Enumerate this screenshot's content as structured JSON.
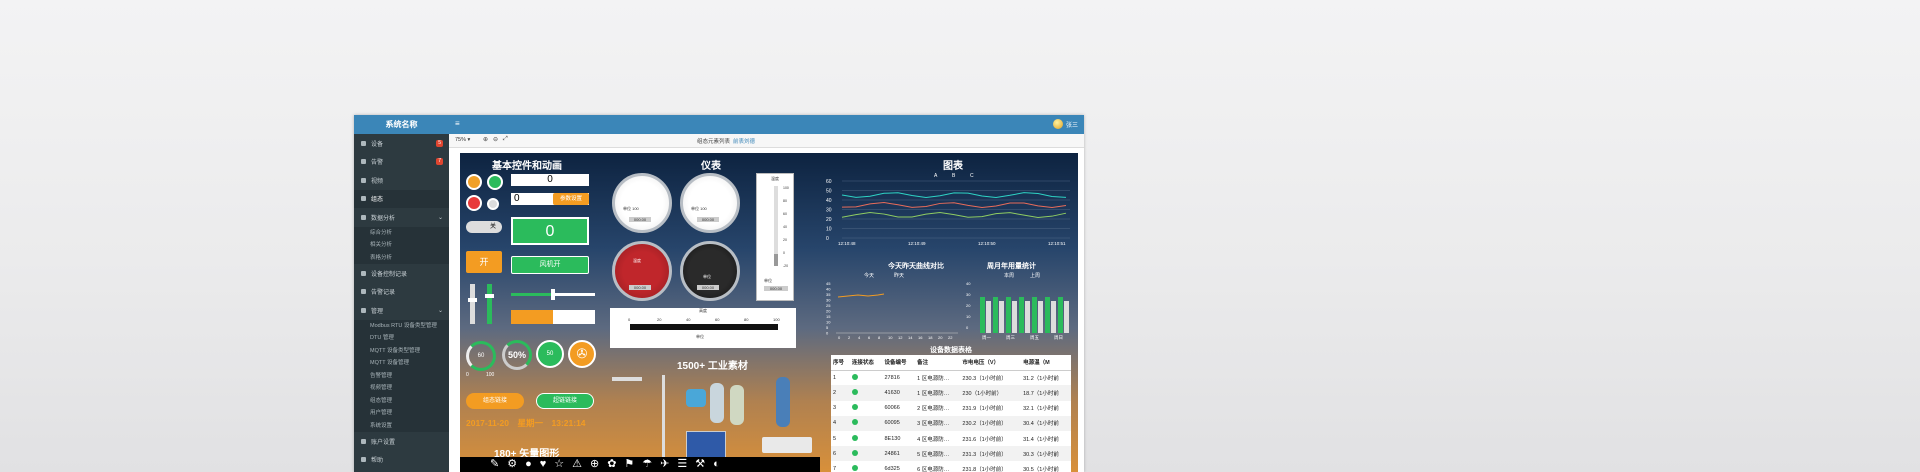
{
  "brand": "系统名称",
  "user": {
    "name": "张三"
  },
  "sidebar": {
    "items": [
      {
        "label": "设备",
        "badge": "5"
      },
      {
        "label": "告警",
        "badge": "7"
      },
      {
        "label": "视频"
      },
      {
        "label": "组态"
      },
      {
        "label": "数据分析",
        "subs": [
          "综合分析",
          "相关分析",
          "表格分析"
        ]
      },
      {
        "label": "设备控制记录"
      },
      {
        "label": "告警记录"
      },
      {
        "label": "管理",
        "subs": [
          "Modbus RTU 设备类型管理",
          "DTU 管理",
          "MQTT 设备类型管理",
          "MQTT 设备管理",
          "告警管理",
          "视频管理",
          "组态管理",
          "用户管理",
          "系统设置"
        ]
      },
      {
        "label": "账户设置"
      },
      {
        "label": "帮助"
      }
    ]
  },
  "toolbar": {
    "zoom": "75%",
    "title": "组态元素列表",
    "link": "前表刘德"
  },
  "canvas": {
    "sections": {
      "basic": "基本控件和动画",
      "meters": "仪表",
      "charts": "图表",
      "industrial": "1500+ 工业素材",
      "vector": "180+ 矢量图形"
    },
    "basic": {
      "value1": "0",
      "value2": "0",
      "btn_param": "参数设置",
      "big_value": "0",
      "toggle": "关",
      "btn_open": "开",
      "btn_fan": "风机开",
      "ring1_val": "60",
      "ring_min": "0",
      "ring_max": "100",
      "pct": "50%",
      "ring2_val": "50",
      "btn_left": "组态链接",
      "btn_right": "超链链接",
      "datetime": "2017-11-20　星期一　13:21:14"
    },
    "meters": {
      "g1_label": "单位 100",
      "g1_value": "000.00",
      "g2_label": "单位 100",
      "g2_value": "000.00",
      "g3_label": "温度",
      "g3_value": "000.00",
      "g4_label": "单位",
      "g4_value": "000.00",
      "thermo_title": "温度",
      "thermo_ticks": [
        "100",
        "80",
        "60",
        "40",
        "20",
        "0",
        "-20"
      ],
      "thermo_value": "000.00",
      "thermo_unit": "单位",
      "ruler_title": "高度",
      "ruler_ticks": [
        "0",
        "20",
        "40",
        "60",
        "80",
        "100"
      ],
      "ruler_unit": "单位"
    },
    "charts": {
      "chart1": {
        "legend": [
          "A",
          "B",
          "C"
        ],
        "y": [
          "60",
          "50",
          "40",
          "30",
          "20",
          "10",
          "0"
        ],
        "x": [
          "12:10:48",
          "12:10:49",
          "12:10:50",
          "12:10:51"
        ]
      },
      "chart2": {
        "title": "今天昨天曲线对比",
        "legend": [
          "今天",
          "昨天"
        ],
        "y": [
          "45",
          "40",
          "35",
          "30",
          "25",
          "20",
          "15",
          "10",
          "5",
          "0"
        ],
        "x": [
          "0",
          "2",
          "4",
          "6",
          "8",
          "10",
          "12",
          "14",
          "16",
          "18",
          "20",
          "22"
        ]
      },
      "chart3": {
        "title": "周月年用量统计",
        "legend": [
          "本周",
          "上周"
        ],
        "y": [
          "40",
          "30",
          "20",
          "10",
          "0"
        ],
        "x": [
          "周一",
          "周三",
          "周五",
          "周日"
        ]
      }
    },
    "table": {
      "title": "设备数据表格",
      "headers": [
        "序号",
        "连接状态",
        "设备编号",
        "备注",
        "市电电压（V）",
        "电源温（M"
      ],
      "rows": [
        [
          "1",
          "",
          "27816",
          "1 区电源防…",
          "230.3（1小时前）",
          "31.2（1小时前"
        ],
        [
          "2",
          "",
          "41630",
          "1 区电源防…",
          "230（1小时前）",
          "18.7（1小时前"
        ],
        [
          "3",
          "",
          "60066",
          "2 区电源防…",
          "231.9（1小时前）",
          "32.1（1小时前"
        ],
        [
          "4",
          "",
          "60095",
          "3 区电源防…",
          "230.2（1小时前）",
          "30.4（1小时前"
        ],
        [
          "5",
          "",
          "8E130",
          "4 区电源防…",
          "231.6（1小时前）",
          "31.4（1小时前"
        ],
        [
          "6",
          "",
          "24861",
          "5 区电源防…",
          "231.3（1小时前）",
          "30.3（1小时前"
        ],
        [
          "7",
          "",
          "6d325",
          "6 区电源防…",
          "231.8（1小时前）",
          "30.5（1小时前"
        ]
      ]
    }
  }
}
